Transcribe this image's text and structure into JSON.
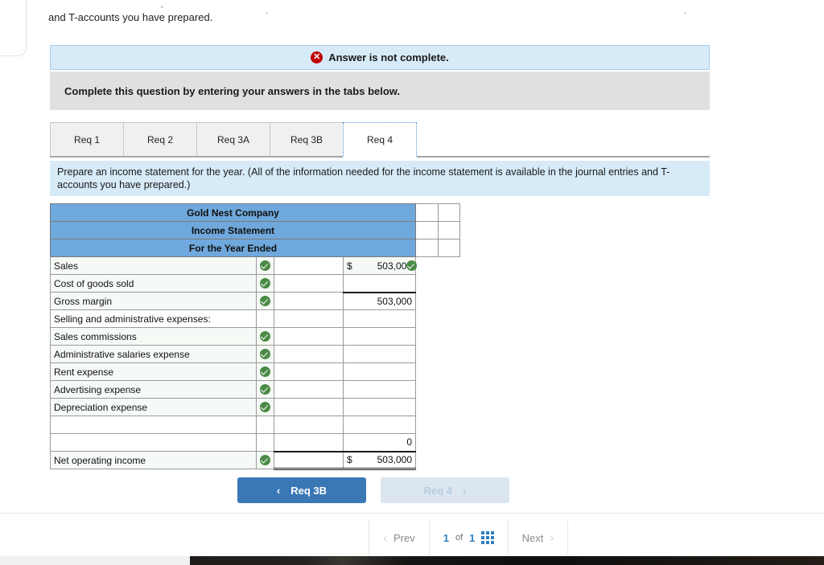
{
  "top_text": "and T-accounts you have prepared.",
  "alert": {
    "icon": "x-circle-icon",
    "text": "Answer is not complete."
  },
  "instruction": "Complete this question by entering your answers in the tabs below.",
  "tabs": [
    {
      "label": "Req 1",
      "active": false
    },
    {
      "label": "Req 2",
      "active": false
    },
    {
      "label": "Req 3A",
      "active": false
    },
    {
      "label": "Req 3B",
      "active": false
    },
    {
      "label": "Req 4",
      "active": true
    }
  ],
  "question": "Prepare an income statement for the year. (All of the information needed for the income statement is available in the journal entries and T-accounts you have prepared.)",
  "sheet": {
    "headers": [
      "Gold Nest Company",
      "Income Statement",
      "For the Year Ended"
    ],
    "rows": [
      {
        "label": "Sales",
        "indent": false,
        "check": true,
        "mid": "",
        "amount": "503,000",
        "dollar": true,
        "amount_check": true
      },
      {
        "label": "Cost of goods sold",
        "indent": false,
        "check": true,
        "mid": "",
        "amount": "",
        "dollar": false,
        "amount_check": false
      },
      {
        "label": "Gross margin",
        "indent": false,
        "check": true,
        "mid": "",
        "amount": "503,000",
        "dollar": false,
        "amount_check": false
      },
      {
        "label": "Selling and administrative expenses:",
        "indent": false,
        "check": false,
        "mid": "",
        "amount": "",
        "dollar": false,
        "amount_check": false
      },
      {
        "label": "Sales commissions",
        "indent": true,
        "check": true,
        "mid": "",
        "amount": "",
        "dollar": false,
        "amount_check": false
      },
      {
        "label": "Administrative salaries expense",
        "indent": true,
        "check": true,
        "mid": "",
        "amount": "",
        "dollar": false,
        "amount_check": false
      },
      {
        "label": "Rent expense",
        "indent": true,
        "check": true,
        "mid": "",
        "amount": "",
        "dollar": false,
        "amount_check": false
      },
      {
        "label": "Advertising expense",
        "indent": true,
        "check": true,
        "mid": "",
        "amount": "",
        "dollar": false,
        "amount_check": false
      },
      {
        "label": "Depreciation expense",
        "indent": true,
        "check": true,
        "mid": "",
        "amount": "",
        "dollar": false,
        "amount_check": false
      },
      {
        "label": "",
        "indent": false,
        "check": false,
        "mid": "",
        "amount": "",
        "dollar": false,
        "amount_check": false
      },
      {
        "label": "",
        "indent": false,
        "check": false,
        "mid": "",
        "amount": "0",
        "dollar": false,
        "amount_check": false
      },
      {
        "label": "Net operating income",
        "indent": false,
        "check": true,
        "mid": "",
        "amount": "503,000",
        "dollar": true,
        "amount_check": false
      }
    ]
  },
  "req_nav": {
    "prev_label": "Req 3B",
    "prev_chevron": "‹",
    "next_label": "Req 4",
    "next_chevron": "›"
  },
  "pager": {
    "prev_label": "Prev",
    "prev_chevron": "‹",
    "current": "1",
    "of": "of",
    "total": "1",
    "grid_icon": "grid-3x3-icon",
    "next_label": "Next",
    "next_chevron": "›"
  },
  "colors": {
    "header_blue": "#6fa8dc",
    "info_blue": "#d7eaf8",
    "band_gray": "#e0e0e0",
    "button_blue": "#3a77b5",
    "check_green": "#4a8a46",
    "error_red": "#c00000",
    "accent_link": "#2f7fc1"
  }
}
